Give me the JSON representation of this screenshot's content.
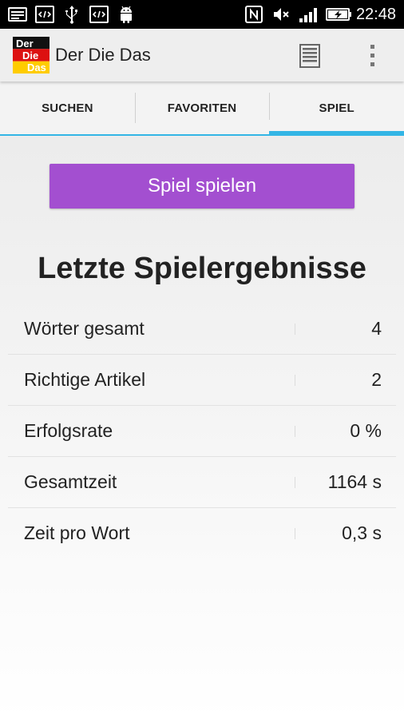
{
  "status_bar": {
    "time": "22:48",
    "left_icons": [
      "image-icon",
      "code-icon",
      "usb-icon",
      "code-icon",
      "android-icon"
    ],
    "right_icons": [
      "nfc-icon",
      "mute-icon",
      "signal-icon",
      "battery-charging-icon"
    ]
  },
  "app_bar": {
    "title": "Der Die Das",
    "logo_words": [
      "Der",
      "Die",
      "Das"
    ],
    "actions": [
      "list-icon",
      "overflow-menu-icon"
    ]
  },
  "tabs": [
    {
      "label": "SUCHEN",
      "active": false
    },
    {
      "label": "FAVORITEN",
      "active": false
    },
    {
      "label": "SPIEL",
      "active": true
    }
  ],
  "main": {
    "play_button_label": "Spiel spielen",
    "results_heading": "Letzte Spielergebnisse",
    "results": [
      {
        "label": "Wörter gesamt",
        "value": "4"
      },
      {
        "label": "Richtige Artikel",
        "value": "2"
      },
      {
        "label": "Erfolgsrate",
        "value": "0 %"
      },
      {
        "label": "Gesamtzeit",
        "value": "1164 s"
      },
      {
        "label": "Zeit pro Wort",
        "value": "0,3 s"
      }
    ]
  },
  "colors": {
    "accent": "#33b5e5",
    "play_button": "#a34fd0",
    "app_bar": "#eeeeee",
    "status_bar": "#000000"
  }
}
